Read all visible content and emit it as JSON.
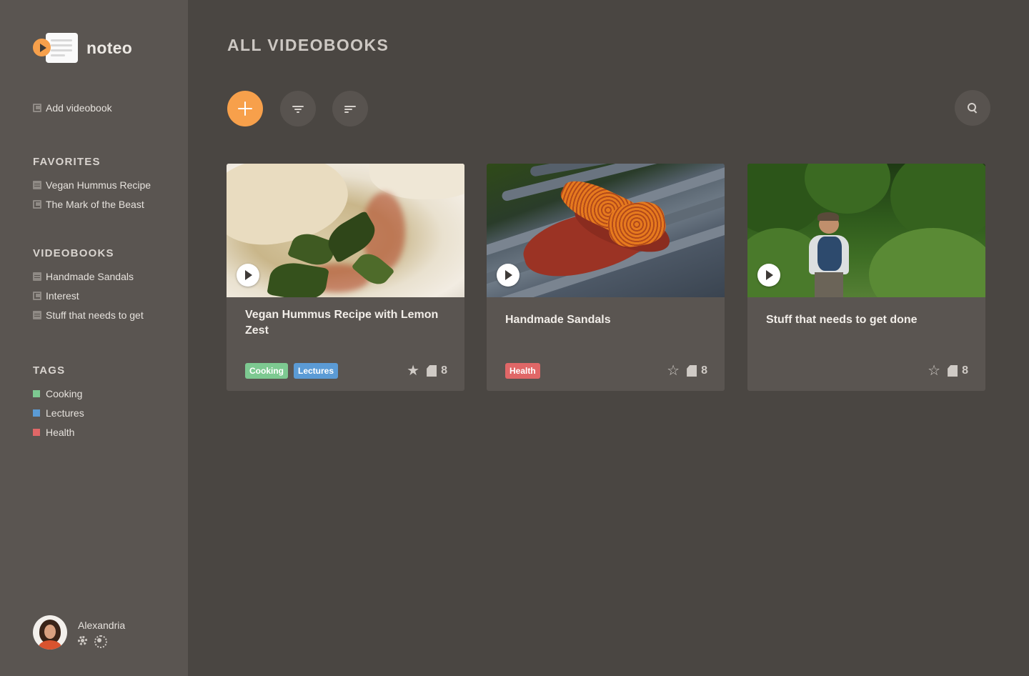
{
  "app": {
    "name": "noteo"
  },
  "sidebar": {
    "add_label": "Add videobook",
    "favorites": {
      "title": "FAVORITES",
      "items": [
        {
          "label": "Vegan Hummus Recipe",
          "icon": "document-icon"
        },
        {
          "label": "The Mark of the Beast",
          "icon": "collection-icon"
        }
      ]
    },
    "videobooks": {
      "title": "VIDEOBOOKS",
      "items": [
        {
          "label": "Handmade Sandals",
          "icon": "document-icon"
        },
        {
          "label": "Interest",
          "icon": "collection-icon"
        },
        {
          "label": "Stuff that needs to get",
          "icon": "document-icon"
        }
      ]
    },
    "tags": {
      "title": "TAGS",
      "items": [
        {
          "label": "Cooking",
          "color": "#7dc991"
        },
        {
          "label": "Lectures",
          "color": "#5b9bd5"
        },
        {
          "label": "Health",
          "color": "#e06767"
        }
      ]
    },
    "user": {
      "name": "Alexandria"
    }
  },
  "main": {
    "title": "ALL VIDEOBOOKS",
    "cards": [
      {
        "title": "Vegan Hummus Recipe with Lemon Zest",
        "tags": [
          {
            "label": "Cooking",
            "color": "#7dc991"
          },
          {
            "label": "Lectures",
            "color": "#5b9bd5"
          }
        ],
        "favorite": true,
        "star": "★",
        "count": "8"
      },
      {
        "title": "Handmade Sandals",
        "tags": [
          {
            "label": "Health",
            "color": "#e06767"
          }
        ],
        "favorite": false,
        "star": "☆",
        "count": "8"
      },
      {
        "title": "Stuff that needs to get done",
        "tags": [],
        "favorite": false,
        "star": "☆",
        "count": "8"
      }
    ]
  },
  "colors": {
    "accent": "#f7a04b",
    "background": "#4a4642",
    "sidebar": "#5a5551"
  }
}
